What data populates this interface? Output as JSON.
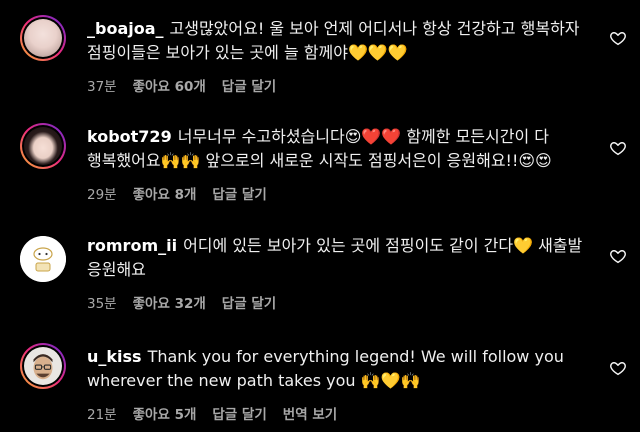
{
  "comments": [
    {
      "username": "_boajoa_",
      "text": "고생많았어요! 울 보아 언제 어디서나 항상 건강하고 행복하자 점핑이들은 보아가 있는 곳에 늘 함께야💛💛💛",
      "time": "37분",
      "likes": "좋아요 60개",
      "reply": "답글 달기",
      "translate": ""
    },
    {
      "username": "kobot729",
      "text": "너무너무 수고하셨습니다😍❤️❤️ 함께한 모든시간이 다 행복했어요🙌🙌 앞으로의 새로운 시작도 점핑서은이 응원해요!!😍😍",
      "time": "29분",
      "likes": "좋아요 8개",
      "reply": "답글 달기",
      "translate": ""
    },
    {
      "username": "romrom_ii",
      "text": "어디에 있든 보아가 있는 곳에 점핑이도 같이 간다💛 새출발 응원해요",
      "time": "35분",
      "likes": "좋아요 32개",
      "reply": "답글 달기",
      "translate": ""
    },
    {
      "username": "u_kiss",
      "text": "Thank you for everything legend! We will follow you wherever the new path takes you 🙌💛🙌",
      "time": "21분",
      "likes": "좋아요 5개",
      "reply": "답글 달기",
      "translate": "번역 보기"
    }
  ],
  "colors": {
    "background": "#000000",
    "text": "#f5f5f5",
    "meta": "#a8a8a8"
  },
  "icons": {
    "like": "heart-outline-icon"
  }
}
